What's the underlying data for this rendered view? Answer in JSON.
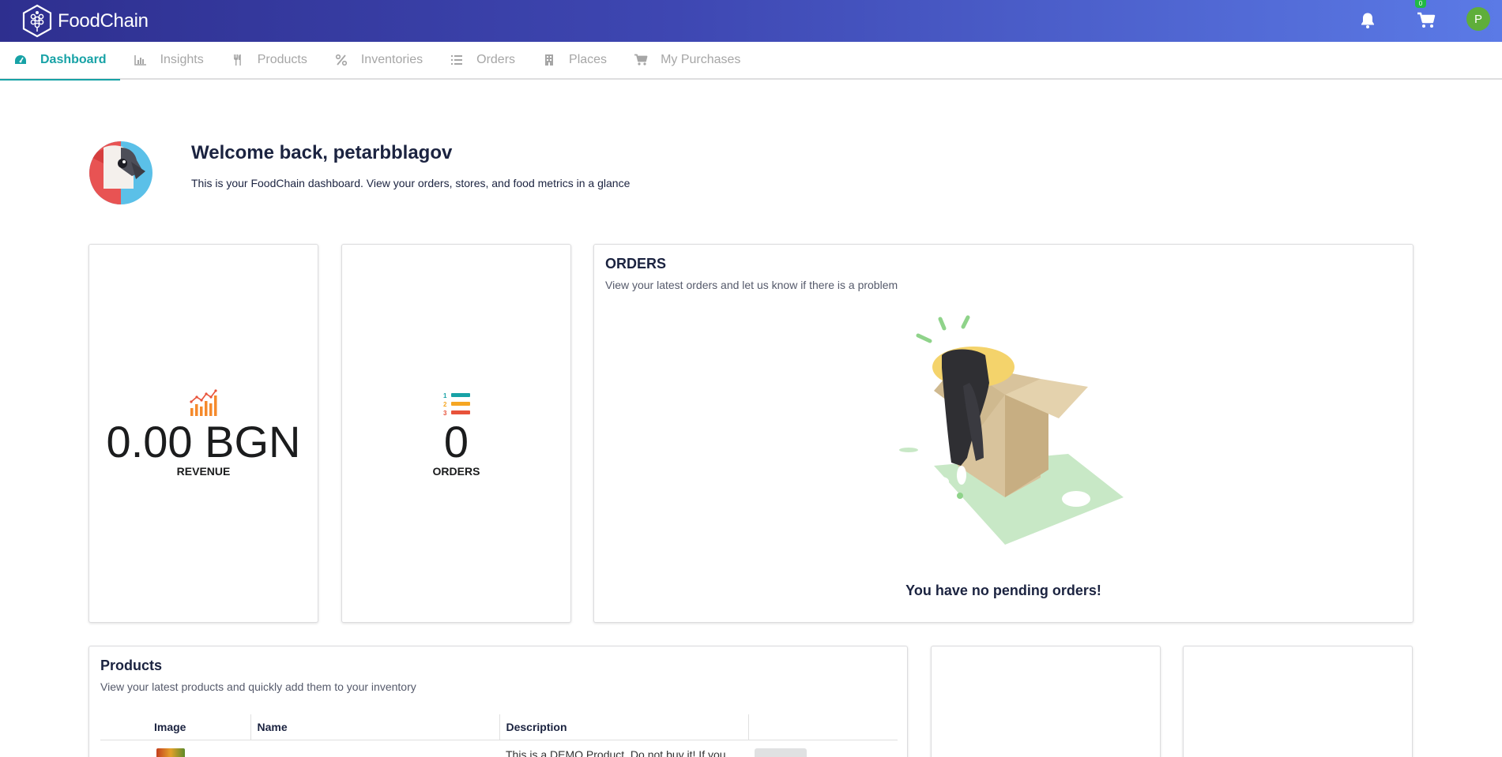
{
  "app": {
    "name": "FoodChain"
  },
  "header": {
    "cart_badge": "0",
    "user_initial": "P"
  },
  "tabs": [
    {
      "label": "Dashboard",
      "icon": "dashboard-icon",
      "active": true
    },
    {
      "label": "Insights",
      "icon": "bar-chart-icon",
      "active": false
    },
    {
      "label": "Products",
      "icon": "utensils-icon",
      "active": false
    },
    {
      "label": "Inventories",
      "icon": "percent-icon",
      "active": false
    },
    {
      "label": "Orders",
      "icon": "list-icon",
      "active": false
    },
    {
      "label": "Places",
      "icon": "building-icon",
      "active": false
    },
    {
      "label": "My Purchases",
      "icon": "cart-icon",
      "active": false
    }
  ],
  "welcome": {
    "title": "Welcome back, petarbblagov",
    "subtitle": "This is your FoodChain dashboard. View your orders, stores, and food metrics in a glance"
  },
  "stats": {
    "revenue": {
      "value": "0.00 BGN",
      "label": "REVENUE"
    },
    "orders": {
      "value": "0",
      "label": "ORDERS"
    }
  },
  "orders_panel": {
    "title": "ORDERS",
    "subtitle": "View your latest orders and let us know if there is a problem",
    "empty_message": "You have no pending orders!"
  },
  "products_panel": {
    "title": "Products",
    "subtitle": "View your latest products and quickly add them to your inventory",
    "columns": [
      "Image",
      "Name",
      "Description",
      ""
    ],
    "rows": [
      {
        "name": "",
        "description": "This is a DEMO Product. Do not buy it! If you"
      }
    ]
  },
  "colors": {
    "accent": "#17a2a6",
    "topbar_start": "#2e2f8f",
    "topbar_end": "#5b7ae6",
    "revenue_icon": "#f58a2c",
    "success": "#21ba45"
  }
}
